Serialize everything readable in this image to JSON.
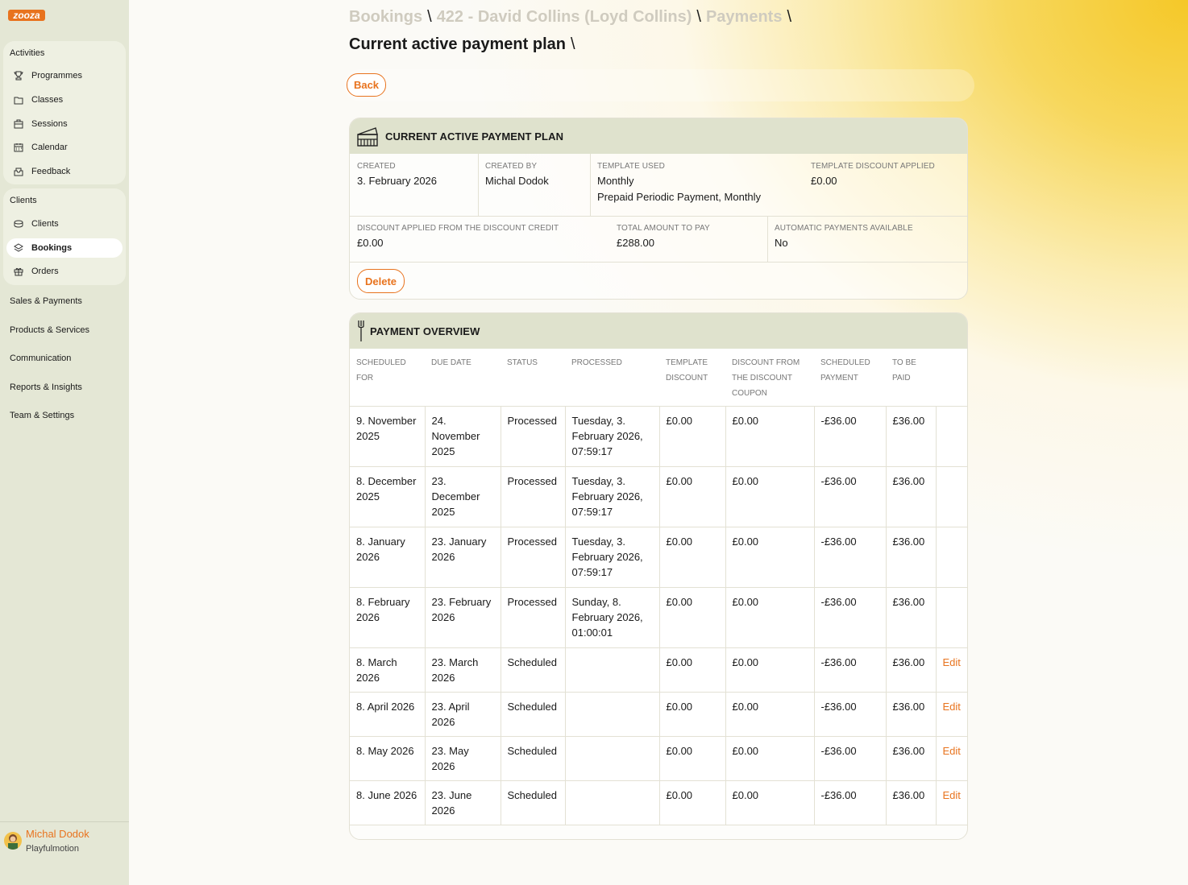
{
  "brand": {
    "logo_text": "zooza",
    "accent": "#e8731e"
  },
  "sidebar": {
    "activities_title": "Activities",
    "activities": [
      {
        "label": "Programmes",
        "icon": "trophy-icon"
      },
      {
        "label": "Classes",
        "icon": "folder-icon"
      },
      {
        "label": "Sessions",
        "icon": "briefcase-icon"
      },
      {
        "label": "Calendar",
        "icon": "calendar-icon"
      },
      {
        "label": "Feedback",
        "icon": "inbox-icon"
      }
    ],
    "clients_title": "Clients",
    "clients": [
      {
        "label": "Clients",
        "icon": "coins-icon"
      },
      {
        "label": "Bookings",
        "icon": "layers-icon",
        "active": true
      },
      {
        "label": "Orders",
        "icon": "gift-icon"
      }
    ],
    "links": [
      "Sales & Payments",
      "Products & Services",
      "Communication",
      "Reports & Insights",
      "Team & Settings"
    ],
    "user": {
      "name": "Michal Dodok",
      "org": "Playfulmotion"
    }
  },
  "header": {
    "breadcrumb": [
      "Bookings",
      "422 - David Collins (Loyd Collins)",
      "Payments"
    ],
    "separator": "\\",
    "title": "Current active payment plan"
  },
  "toolbar": {
    "back_label": "Back"
  },
  "plan": {
    "title": "CURRENT ACTIVE PAYMENT PLAN",
    "created_label": "CREATED",
    "created": "3. February 2026",
    "created_by_label": "CREATED BY",
    "created_by": "Michal Dodok",
    "template_label": "TEMPLATE USED",
    "template_line1": "Monthly",
    "template_line2": "Prepaid Periodic Payment, Monthly",
    "template_discount_label": "TEMPLATE DISCOUNT APPLIED",
    "template_discount": "£0.00",
    "credit_discount_label": "DISCOUNT APPLIED FROM THE DISCOUNT CREDIT",
    "credit_discount": "£0.00",
    "total_label": "TOTAL AMOUNT TO PAY",
    "total": "£288.00",
    "auto_label": "AUTOMATIC PAYMENTS AVAILABLE",
    "auto": "No",
    "delete_label": "Delete"
  },
  "overview": {
    "title": "PAYMENT OVERVIEW",
    "columns": [
      "SCHEDULED FOR",
      "DUE DATE",
      "STATUS",
      "PROCESSED",
      "TEMPLATE DISCOUNT",
      "DISCOUNT FROM THE DISCOUNT COUPON",
      "SCHEDULED PAYMENT",
      "TO BE PAID",
      ""
    ],
    "edit_label": "Edit",
    "rows": [
      {
        "scheduled": "9. November 2025",
        "due": "24. November 2025",
        "status": "Processed",
        "processed": "Tuesday, 3. February 2026, 07:59:17",
        "tdisc": "£0.00",
        "cdisc": "£0.00",
        "payment": "-£36.00",
        "topay": "£36.00",
        "edit": ""
      },
      {
        "scheduled": "8. December 2025",
        "due": "23. December 2025",
        "status": "Processed",
        "processed": "Tuesday, 3. February 2026, 07:59:17",
        "tdisc": "£0.00",
        "cdisc": "£0.00",
        "payment": "-£36.00",
        "topay": "£36.00",
        "edit": ""
      },
      {
        "scheduled": "8. January 2026",
        "due": "23. January 2026",
        "status": "Processed",
        "processed": "Tuesday, 3. February 2026, 07:59:17",
        "tdisc": "£0.00",
        "cdisc": "£0.00",
        "payment": "-£36.00",
        "topay": "£36.00",
        "edit": ""
      },
      {
        "scheduled": "8. February 2026",
        "due": "23. February 2026",
        "status": "Processed",
        "processed": "Sunday, 8. February 2026, 01:00:01",
        "tdisc": "£0.00",
        "cdisc": "£0.00",
        "payment": "-£36.00",
        "topay": "£36.00",
        "edit": ""
      },
      {
        "scheduled": "8. March 2026",
        "due": "23. March 2026",
        "status": "Scheduled",
        "processed": "",
        "tdisc": "£0.00",
        "cdisc": "£0.00",
        "payment": "-£36.00",
        "topay": "£36.00",
        "edit": "Edit"
      },
      {
        "scheduled": "8. April 2026",
        "due": "23. April 2026",
        "status": "Scheduled",
        "processed": "",
        "tdisc": "£0.00",
        "cdisc": "£0.00",
        "payment": "-£36.00",
        "topay": "£36.00",
        "edit": "Edit"
      },
      {
        "scheduled": "8. May 2026",
        "due": "23. May 2026",
        "status": "Scheduled",
        "processed": "",
        "tdisc": "£0.00",
        "cdisc": "£0.00",
        "payment": "-£36.00",
        "topay": "£36.00",
        "edit": "Edit"
      },
      {
        "scheduled": "8. June 2026",
        "due": "23. June 2026",
        "status": "Scheduled",
        "processed": "",
        "tdisc": "£0.00",
        "cdisc": "£0.00",
        "payment": "-£36.00",
        "topay": "£36.00",
        "edit": "Edit"
      }
    ]
  }
}
